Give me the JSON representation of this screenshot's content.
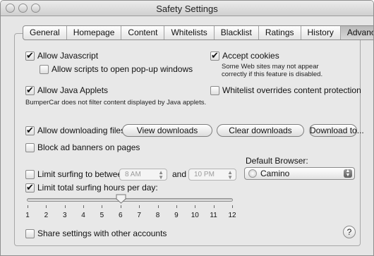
{
  "window": {
    "title": "Safety Settings"
  },
  "tabs": [
    "General",
    "Homepage",
    "Content",
    "Whitelists",
    "Blacklist",
    "Ratings",
    "History",
    "Advanced"
  ],
  "active_tab": "Advanced",
  "options": {
    "allow_javascript": {
      "label": "Allow Javascript",
      "checked": true
    },
    "allow_popups": {
      "label": "Allow scripts to open pop-up windows",
      "checked": false
    },
    "accept_cookies": {
      "label": "Accept cookies",
      "checked": true
    },
    "cookies_note_line1": "Some Web sites may not appear",
    "cookies_note_line2": "correctly if this feature is disabled.",
    "allow_java_applets": {
      "label": "Allow Java Applets",
      "checked": true
    },
    "java_note": "BumperCar does not filter content displayed by Java applets.",
    "whitelist_overrides": {
      "label": "Whitelist overrides content protection",
      "checked": false
    },
    "allow_downloading": {
      "label": "Allow downloading files",
      "checked": true
    },
    "block_ads": {
      "label": "Block ad banners on pages",
      "checked": false
    },
    "limit_between": {
      "label": "Limit surfing to between",
      "checked": false
    },
    "limit_total_hours": {
      "label": "Limit total surfing hours per day:",
      "checked": true
    },
    "share_settings": {
      "label": "Share settings with other accounts",
      "checked": false
    }
  },
  "buttons": {
    "view_downloads": "View downloads",
    "clear_downloads": "Clear downloads",
    "download_to": "Download to..."
  },
  "time_range": {
    "start": "8 AM",
    "and_label": "and",
    "end": "10 PM"
  },
  "default_browser": {
    "label": "Default Browser:",
    "value": "Camino"
  },
  "hours_slider": {
    "min": 1,
    "max": 12,
    "value": 6,
    "tick_labels": [
      "1",
      "2",
      "3",
      "4",
      "5",
      "6",
      "7",
      "8",
      "9",
      "10",
      "11",
      "12"
    ]
  },
  "help": "?",
  "icons": {
    "close": "close-icon",
    "minimize": "minimize-icon",
    "zoom": "zoom-icon",
    "checkmark": "checkmark-icon",
    "browser": "camino-browser-icon",
    "stepper": "stepper-arrows-icon",
    "help": "help-icon"
  }
}
